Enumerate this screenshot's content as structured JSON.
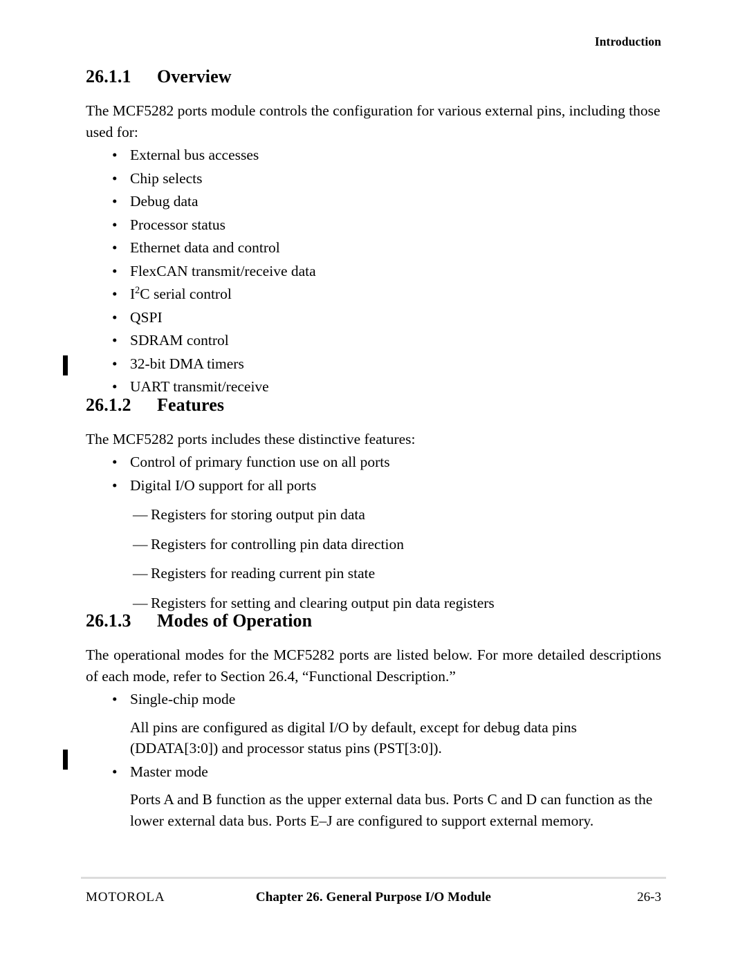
{
  "header": {
    "running_head": "Introduction"
  },
  "sections": [
    {
      "number": "26.1.1",
      "title": "Overview",
      "intro": "The MCF5282 ports module controls the configuration for various external pins, including those used for:",
      "bullets": [
        "External bus accesses",
        "Chip selects",
        "Debug data",
        "Processor status",
        "Ethernet data and control",
        "FlexCAN transmit/receive data",
        "I2C serial control",
        "QSPI",
        "SDRAM control",
        "32-bit DMA timers",
        "UART transmit/receive"
      ],
      "i2c": {
        "base": "I",
        "sup": "2",
        "rest": "C serial control"
      }
    },
    {
      "number": "26.1.2",
      "title": "Features",
      "intro": "The MCF5282 ports includes these distinctive features:",
      "bullets": [
        "Control of primary function use on all ports",
        "Digital I/O support for all ports"
      ],
      "subbullets": [
        "Registers for storing output pin data",
        "Registers for controlling pin data direction",
        "Registers for reading current pin state",
        "Registers for setting and clearing output pin data registers"
      ]
    },
    {
      "number": "26.1.3",
      "title": "Modes of Operation",
      "intro": "The operational modes for the MCF5282 ports are listed below. For more detailed descriptions of each mode, refer to Section 26.4, “Functional Description.”",
      "modes": [
        {
          "label": "Single-chip mode",
          "description": "All pins are configured as digital I/O by default, except for debug data pins (DDATA[3:0]) and processor status pins (PST[3:0])."
        },
        {
          "label": "Master mode",
          "description": "Ports A and B function as the upper external data bus. Ports C and D can function as the lower external data bus. Ports E–J are configured to support external memory."
        }
      ]
    }
  ],
  "footer": {
    "left": "MOTOROLA",
    "center": "Chapter 26. General Purpose I/O Module",
    "right": "26-3"
  },
  "colors": {
    "text": "#000000",
    "page_background": "#ffffff",
    "footer_rule": "#dcdcdc",
    "change_bar": "#000000"
  }
}
